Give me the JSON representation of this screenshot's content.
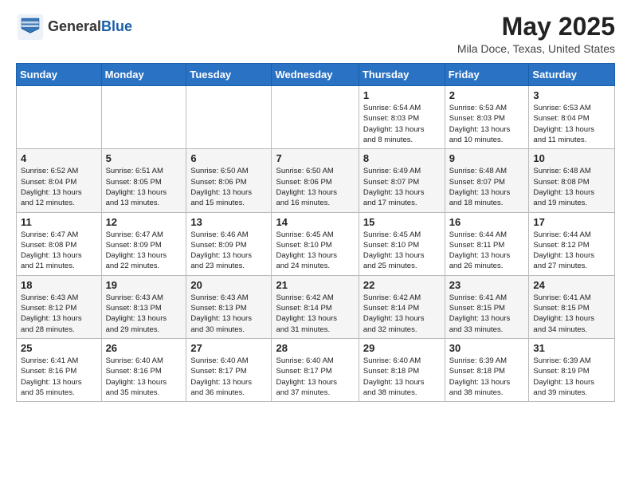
{
  "header": {
    "logo_line1": "General",
    "logo_line2": "Blue",
    "month_title": "May 2025",
    "location": "Mila Doce, Texas, United States"
  },
  "weekdays": [
    "Sunday",
    "Monday",
    "Tuesday",
    "Wednesday",
    "Thursday",
    "Friday",
    "Saturday"
  ],
  "weeks": [
    [
      {
        "day": "",
        "info": ""
      },
      {
        "day": "",
        "info": ""
      },
      {
        "day": "",
        "info": ""
      },
      {
        "day": "",
        "info": ""
      },
      {
        "day": "1",
        "info": "Sunrise: 6:54 AM\nSunset: 8:03 PM\nDaylight: 13 hours\nand 8 minutes."
      },
      {
        "day": "2",
        "info": "Sunrise: 6:53 AM\nSunset: 8:03 PM\nDaylight: 13 hours\nand 10 minutes."
      },
      {
        "day": "3",
        "info": "Sunrise: 6:53 AM\nSunset: 8:04 PM\nDaylight: 13 hours\nand 11 minutes."
      }
    ],
    [
      {
        "day": "4",
        "info": "Sunrise: 6:52 AM\nSunset: 8:04 PM\nDaylight: 13 hours\nand 12 minutes."
      },
      {
        "day": "5",
        "info": "Sunrise: 6:51 AM\nSunset: 8:05 PM\nDaylight: 13 hours\nand 13 minutes."
      },
      {
        "day": "6",
        "info": "Sunrise: 6:50 AM\nSunset: 8:06 PM\nDaylight: 13 hours\nand 15 minutes."
      },
      {
        "day": "7",
        "info": "Sunrise: 6:50 AM\nSunset: 8:06 PM\nDaylight: 13 hours\nand 16 minutes."
      },
      {
        "day": "8",
        "info": "Sunrise: 6:49 AM\nSunset: 8:07 PM\nDaylight: 13 hours\nand 17 minutes."
      },
      {
        "day": "9",
        "info": "Sunrise: 6:48 AM\nSunset: 8:07 PM\nDaylight: 13 hours\nand 18 minutes."
      },
      {
        "day": "10",
        "info": "Sunrise: 6:48 AM\nSunset: 8:08 PM\nDaylight: 13 hours\nand 19 minutes."
      }
    ],
    [
      {
        "day": "11",
        "info": "Sunrise: 6:47 AM\nSunset: 8:08 PM\nDaylight: 13 hours\nand 21 minutes."
      },
      {
        "day": "12",
        "info": "Sunrise: 6:47 AM\nSunset: 8:09 PM\nDaylight: 13 hours\nand 22 minutes."
      },
      {
        "day": "13",
        "info": "Sunrise: 6:46 AM\nSunset: 8:09 PM\nDaylight: 13 hours\nand 23 minutes."
      },
      {
        "day": "14",
        "info": "Sunrise: 6:45 AM\nSunset: 8:10 PM\nDaylight: 13 hours\nand 24 minutes."
      },
      {
        "day": "15",
        "info": "Sunrise: 6:45 AM\nSunset: 8:10 PM\nDaylight: 13 hours\nand 25 minutes."
      },
      {
        "day": "16",
        "info": "Sunrise: 6:44 AM\nSunset: 8:11 PM\nDaylight: 13 hours\nand 26 minutes."
      },
      {
        "day": "17",
        "info": "Sunrise: 6:44 AM\nSunset: 8:12 PM\nDaylight: 13 hours\nand 27 minutes."
      }
    ],
    [
      {
        "day": "18",
        "info": "Sunrise: 6:43 AM\nSunset: 8:12 PM\nDaylight: 13 hours\nand 28 minutes."
      },
      {
        "day": "19",
        "info": "Sunrise: 6:43 AM\nSunset: 8:13 PM\nDaylight: 13 hours\nand 29 minutes."
      },
      {
        "day": "20",
        "info": "Sunrise: 6:43 AM\nSunset: 8:13 PM\nDaylight: 13 hours\nand 30 minutes."
      },
      {
        "day": "21",
        "info": "Sunrise: 6:42 AM\nSunset: 8:14 PM\nDaylight: 13 hours\nand 31 minutes."
      },
      {
        "day": "22",
        "info": "Sunrise: 6:42 AM\nSunset: 8:14 PM\nDaylight: 13 hours\nand 32 minutes."
      },
      {
        "day": "23",
        "info": "Sunrise: 6:41 AM\nSunset: 8:15 PM\nDaylight: 13 hours\nand 33 minutes."
      },
      {
        "day": "24",
        "info": "Sunrise: 6:41 AM\nSunset: 8:15 PM\nDaylight: 13 hours\nand 34 minutes."
      }
    ],
    [
      {
        "day": "25",
        "info": "Sunrise: 6:41 AM\nSunset: 8:16 PM\nDaylight: 13 hours\nand 35 minutes."
      },
      {
        "day": "26",
        "info": "Sunrise: 6:40 AM\nSunset: 8:16 PM\nDaylight: 13 hours\nand 35 minutes."
      },
      {
        "day": "27",
        "info": "Sunrise: 6:40 AM\nSunset: 8:17 PM\nDaylight: 13 hours\nand 36 minutes."
      },
      {
        "day": "28",
        "info": "Sunrise: 6:40 AM\nSunset: 8:17 PM\nDaylight: 13 hours\nand 37 minutes."
      },
      {
        "day": "29",
        "info": "Sunrise: 6:40 AM\nSunset: 8:18 PM\nDaylight: 13 hours\nand 38 minutes."
      },
      {
        "day": "30",
        "info": "Sunrise: 6:39 AM\nSunset: 8:18 PM\nDaylight: 13 hours\nand 38 minutes."
      },
      {
        "day": "31",
        "info": "Sunrise: 6:39 AM\nSunset: 8:19 PM\nDaylight: 13 hours\nand 39 minutes."
      }
    ]
  ]
}
